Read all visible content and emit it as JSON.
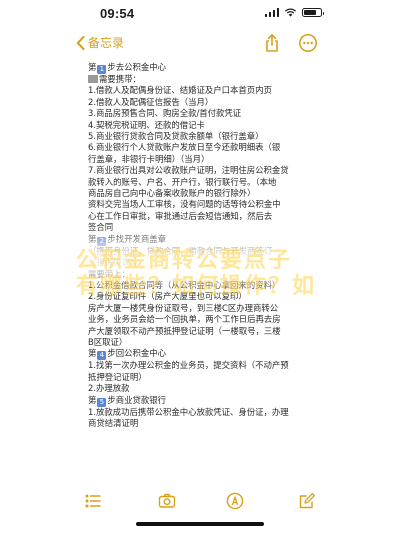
{
  "status": {
    "time": "09:54"
  },
  "nav": {
    "back_label": "备忘录"
  },
  "note": {
    "lines": [
      {
        "pre": "第",
        "step": "1",
        "post": "步去公积金中心"
      },
      {
        "gray": true,
        "text": "需要携带："
      },
      {
        "text": "1.借款人及配偶身份证、结婚证及户口本首页内页"
      },
      {
        "text": "2.借款人及配偶征信报告（当月）"
      },
      {
        "text": "3.商品房预售合同、购房全款/首付款凭证"
      },
      {
        "text": "4.契税完税证明、还款的借记卡"
      },
      {
        "text": "5.商业银行贷款合同及贷款余额单（银行盖章）"
      },
      {
        "text": "6.商业银行个人贷款账户发放日至今还款明细表（银"
      },
      {
        "text": "行盖章，非银行卡明细）（当月）"
      },
      {
        "text": "7.商业银行出具对公收款账户证明，注明住房公积金贷"
      },
      {
        "text": "款转入的账号、户名、开户行，银行联行号。（本地"
      },
      {
        "text": "商品房自己向中心备案收款账户的银行除外）"
      },
      {
        "text": "资料交完当场人工审核，没有问题的话等待公积金中"
      },
      {
        "text": "心在工作日审批，审批通过后会短信通知，然后去"
      },
      {
        "text": "签合同"
      },
      {
        "pre": "第",
        "step": "2",
        "post": "步找开发商盖章"
      },
      {
        "text": "（携带身份证、贷款合同、借款合同与开发商签订"
      },
      {
        "text": "《担保协议》）"
      },
      {
        "text": "需要带上："
      },
      {
        "text": "1.公积金借款合同等（从公积金中心拿回来的资料）"
      },
      {
        "text": "2.身份证复印件（房产大厦里也可以复印）"
      },
      {
        "text": "房产大厦一楼凭身份证取号，到三楼C区办理商转公"
      },
      {
        "text": "业务，业务员会给一个回执单，两个工作日后再去房"
      },
      {
        "text": "产大厦领取不动产预抵押登记证明（一楼取号，三楼"
      },
      {
        "text": "B区取证）"
      },
      {
        "pre": "第",
        "step": "4",
        "post": "步回公积金中心"
      },
      {
        "text": "1.找第一次办理公积金的业务员，提交资料（不动产预"
      },
      {
        "text": "抵押登记证明）"
      },
      {
        "text": "2.办理放款"
      },
      {
        "pre": "第",
        "step": "5",
        "post": "步商业贷款银行"
      },
      {
        "text": "1.放款成功后携带公积金中心放款凭证、身份证，办理"
      },
      {
        "text": "商贷结清证明"
      }
    ]
  },
  "overlay": {
    "line1": "公积金商转公要点子",
    "line2": "有哪些？如何操作？如"
  },
  "colors": {
    "accent": "#d7a11a",
    "step_badge": "#5b86d6"
  },
  "toolbar": {
    "icons": [
      "checklist-icon",
      "camera-icon",
      "markup-icon",
      "compose-icon"
    ]
  }
}
